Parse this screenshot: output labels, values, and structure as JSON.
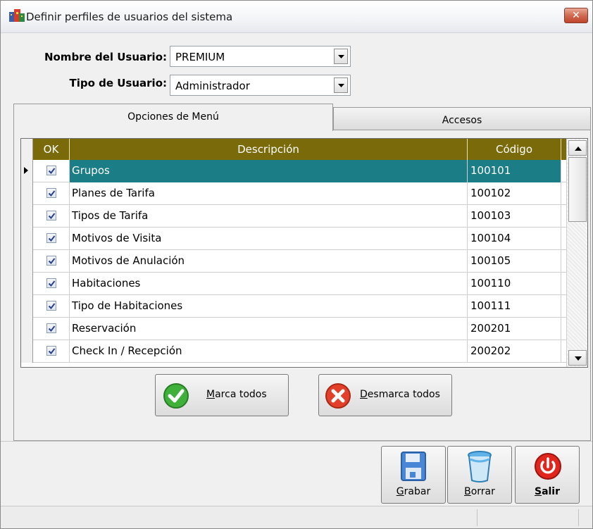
{
  "window": {
    "title": "Definir perfiles de usuarios del sistema",
    "close_glyph": "✕"
  },
  "user": {
    "name_label": "Nombre del Usuario:",
    "name_value": "PREMIUM",
    "type_label": "Tipo de Usuario:",
    "type_value": "Administrador"
  },
  "tabs": [
    {
      "label": "Opciones de Menú",
      "active": true
    },
    {
      "label": "Accesos",
      "active": false
    }
  ],
  "grid": {
    "columns": [
      "OK",
      "Descripción",
      "Código"
    ],
    "rows": [
      {
        "checked": true,
        "description": "Grupos",
        "code": "100101",
        "selected": true
      },
      {
        "checked": true,
        "description": "Planes de Tarifa",
        "code": "100102"
      },
      {
        "checked": true,
        "description": "Tipos de Tarifa",
        "code": "100103"
      },
      {
        "checked": true,
        "description": "Motivos de Visita",
        "code": "100104"
      },
      {
        "checked": true,
        "description": "Motivos de Anulación",
        "code": "100105"
      },
      {
        "checked": true,
        "description": "Habitaciones",
        "code": "100110"
      },
      {
        "checked": true,
        "description": "Tipo de Habitaciones",
        "code": "100111"
      },
      {
        "checked": true,
        "description": "Reservación",
        "code": "200201"
      },
      {
        "checked": true,
        "description": "Check In / Recepción",
        "code": "200202"
      }
    ],
    "header_color": "#7b6a09",
    "selected_color": "#1b7d86"
  },
  "actions": {
    "mark_all": {
      "label": "Marca todos",
      "icon": "green-check-icon"
    },
    "unmark_all": {
      "label": "Desmarca todos",
      "icon": "red-x-icon"
    }
  },
  "toolbar": {
    "save": {
      "label": "Grabar",
      "icon": "floppy-disk-icon"
    },
    "delete": {
      "label": "Borrar",
      "icon": "trash-bin-icon"
    },
    "exit": {
      "label": "Salir",
      "icon": "power-icon"
    }
  }
}
